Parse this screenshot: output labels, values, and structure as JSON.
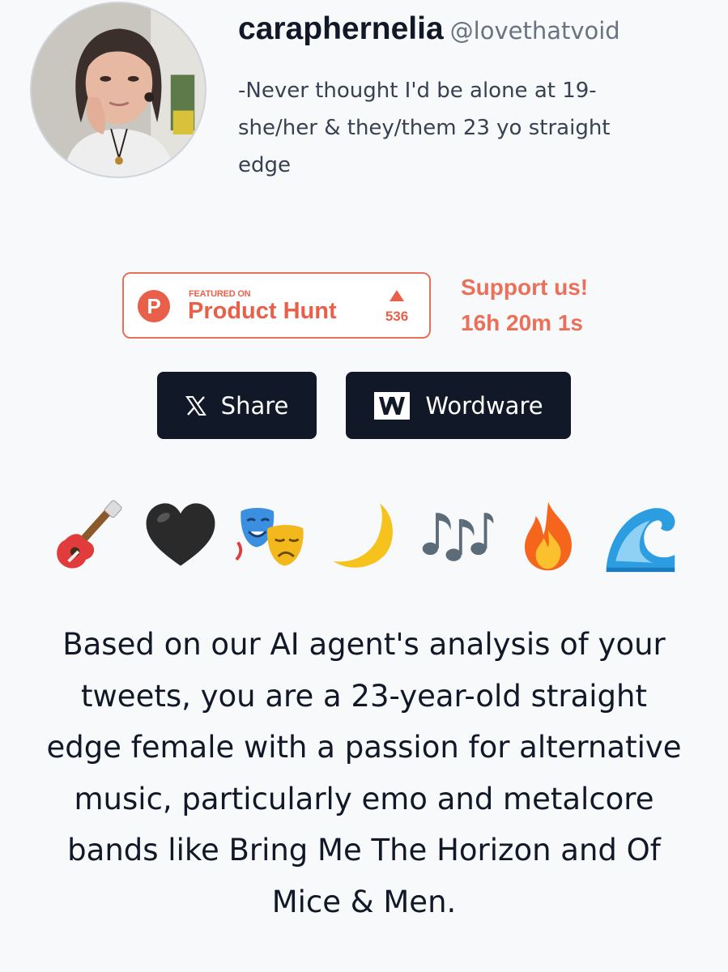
{
  "profile": {
    "display_name": "caraphernelia",
    "handle": "@lovethatvoid",
    "bio_lines": [
      "-Never thought I'd be alone at 19-",
      "she/her & they/them 23 yo straight",
      "edge"
    ]
  },
  "product_hunt": {
    "featured_label": "FEATURED ON",
    "name": "Product Hunt",
    "logo_letter": "P",
    "votes": "536",
    "accent_color": "#e8604a"
  },
  "support": {
    "title": "Support us!",
    "countdown": "16h 20m 1s"
  },
  "buttons": {
    "share_label": "Share",
    "share_icon": "x-logo-icon",
    "wordware_label": "Wordware",
    "wordware_icon": "wordware-logo-icon"
  },
  "emojis": [
    {
      "name": "guitar-icon",
      "char": "🎸"
    },
    {
      "name": "black-heart-icon",
      "char": "🖤"
    },
    {
      "name": "performing-arts-icon",
      "char": "🎭"
    },
    {
      "name": "crescent-moon-icon",
      "char": "🌙"
    },
    {
      "name": "musical-notes-icon",
      "char": "🎶"
    },
    {
      "name": "fire-icon",
      "char": "🔥"
    },
    {
      "name": "water-wave-icon",
      "char": "🌊"
    }
  ],
  "summary_lines": [
    "Based on our AI agent's analysis of your",
    "tweets, you are a 23-year-old straight",
    "edge female with a passion for alternative",
    "music, particularly emo and metalcore",
    "bands like Bring Me The Horizon and Of",
    "Mice & Men."
  ],
  "colors": {
    "background": "#f8f9fb",
    "button_dark": "#111827",
    "accent": "#e8604a"
  }
}
